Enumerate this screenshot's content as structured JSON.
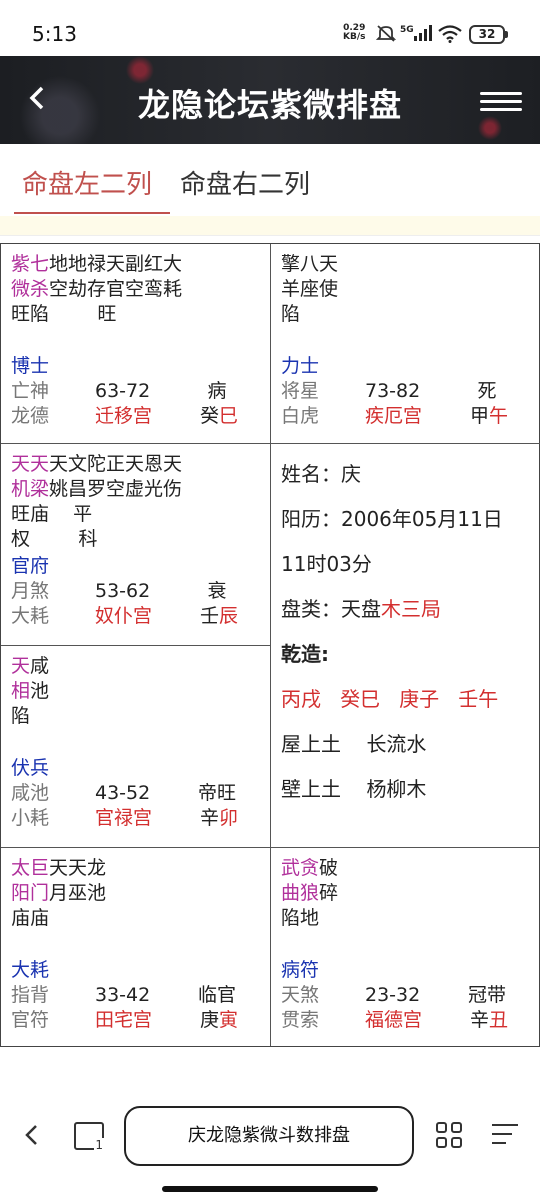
{
  "status_bar": {
    "time": "5:13",
    "net_speed": "0.29",
    "net_unit": "KB/s",
    "signal": "5G",
    "battery": "32"
  },
  "header": {
    "title": "龙隐论坛紫微排盘"
  },
  "tabs": [
    {
      "label": "命盘左二列"
    },
    {
      "label": "命盘右二列"
    }
  ],
  "cells": [
    {
      "stars_main": [
        "紫七",
        "微杀"
      ],
      "stars_minor": [
        "地地禄天副红大",
        "空劫存官空鸾耗"
      ],
      "brightness": "旺陷        旺",
      "transform": "",
      "doctor": "博士",
      "god": "亡神",
      "range": "63-72",
      "stage": "病",
      "year_god": "龙德",
      "palace": "迁移宫",
      "stem": "癸",
      "branch": "巳"
    },
    {
      "stars_main": [
        "",
        ""
      ],
      "stars_minor": [
        "擎八天",
        "羊座使"
      ],
      "brightness": "陷",
      "transform": "",
      "doctor": "力士",
      "god": "将星",
      "range": "73-82",
      "stage": "死",
      "year_god": "白虎",
      "palace": "疾厄宫",
      "stem": "甲",
      "branch": "午"
    },
    {
      "stars_main": [
        "天天",
        "机梁"
      ],
      "stars_minor": [
        "天文陀正天恩天",
        "姚昌罗空虚光伤"
      ],
      "brightness": "旺庙    平",
      "transform": "权        科",
      "doctor": "官府",
      "god": "月煞",
      "range": "53-62",
      "stage": "衰",
      "year_god": "大耗",
      "palace": "奴仆宫",
      "stem": "壬",
      "branch": "辰"
    },
    {
      "stars_main": [
        "天",
        "相"
      ],
      "stars_minor": [
        "咸",
        "池"
      ],
      "brightness": "陷",
      "transform": "",
      "doctor": "伏兵",
      "god": "咸池",
      "range": "43-52",
      "stage": "帝旺",
      "year_god": "小耗",
      "palace": "官禄宫",
      "stem": "辛",
      "branch": "卯"
    },
    {
      "stars_main": [
        "太巨",
        "阳门"
      ],
      "stars_minor": [
        "天天龙",
        "月巫池"
      ],
      "brightness": "庙庙",
      "transform": "",
      "doctor": "大耗",
      "god": "指背",
      "range": "33-42",
      "stage": "临官",
      "year_god": "官符",
      "palace": "田宅宫",
      "stem": "庚",
      "branch": "寅"
    },
    {
      "stars_main": [
        "武贪",
        "曲狼"
      ],
      "stars_minor": [
        "破",
        "碎"
      ],
      "brightness": "陷地",
      "transform": "",
      "doctor": "病符",
      "god": "天煞",
      "range": "23-32",
      "stage": "冠带",
      "year_god": "贯索",
      "palace": "福德宫",
      "stem": "辛",
      "branch": "丑"
    }
  ],
  "info": {
    "name_label": "姓名：",
    "name": "庆",
    "solar_label": "阳历：",
    "solar_date": "2006年05月11日",
    "solar_time": "11时03分",
    "type_label": "盘类：",
    "type_plain": "天盘",
    "type_red": "木三局",
    "gender_label": "乾造:",
    "pillars": [
      "丙戌",
      "癸巳",
      "庚子",
      "壬午"
    ],
    "nayin_1": [
      "屋上土",
      "长流水"
    ],
    "nayin_2": [
      "壁上土",
      "杨柳木"
    ]
  },
  "bottom_nav": {
    "title": "庆龙隐紫微斗数排盘"
  }
}
